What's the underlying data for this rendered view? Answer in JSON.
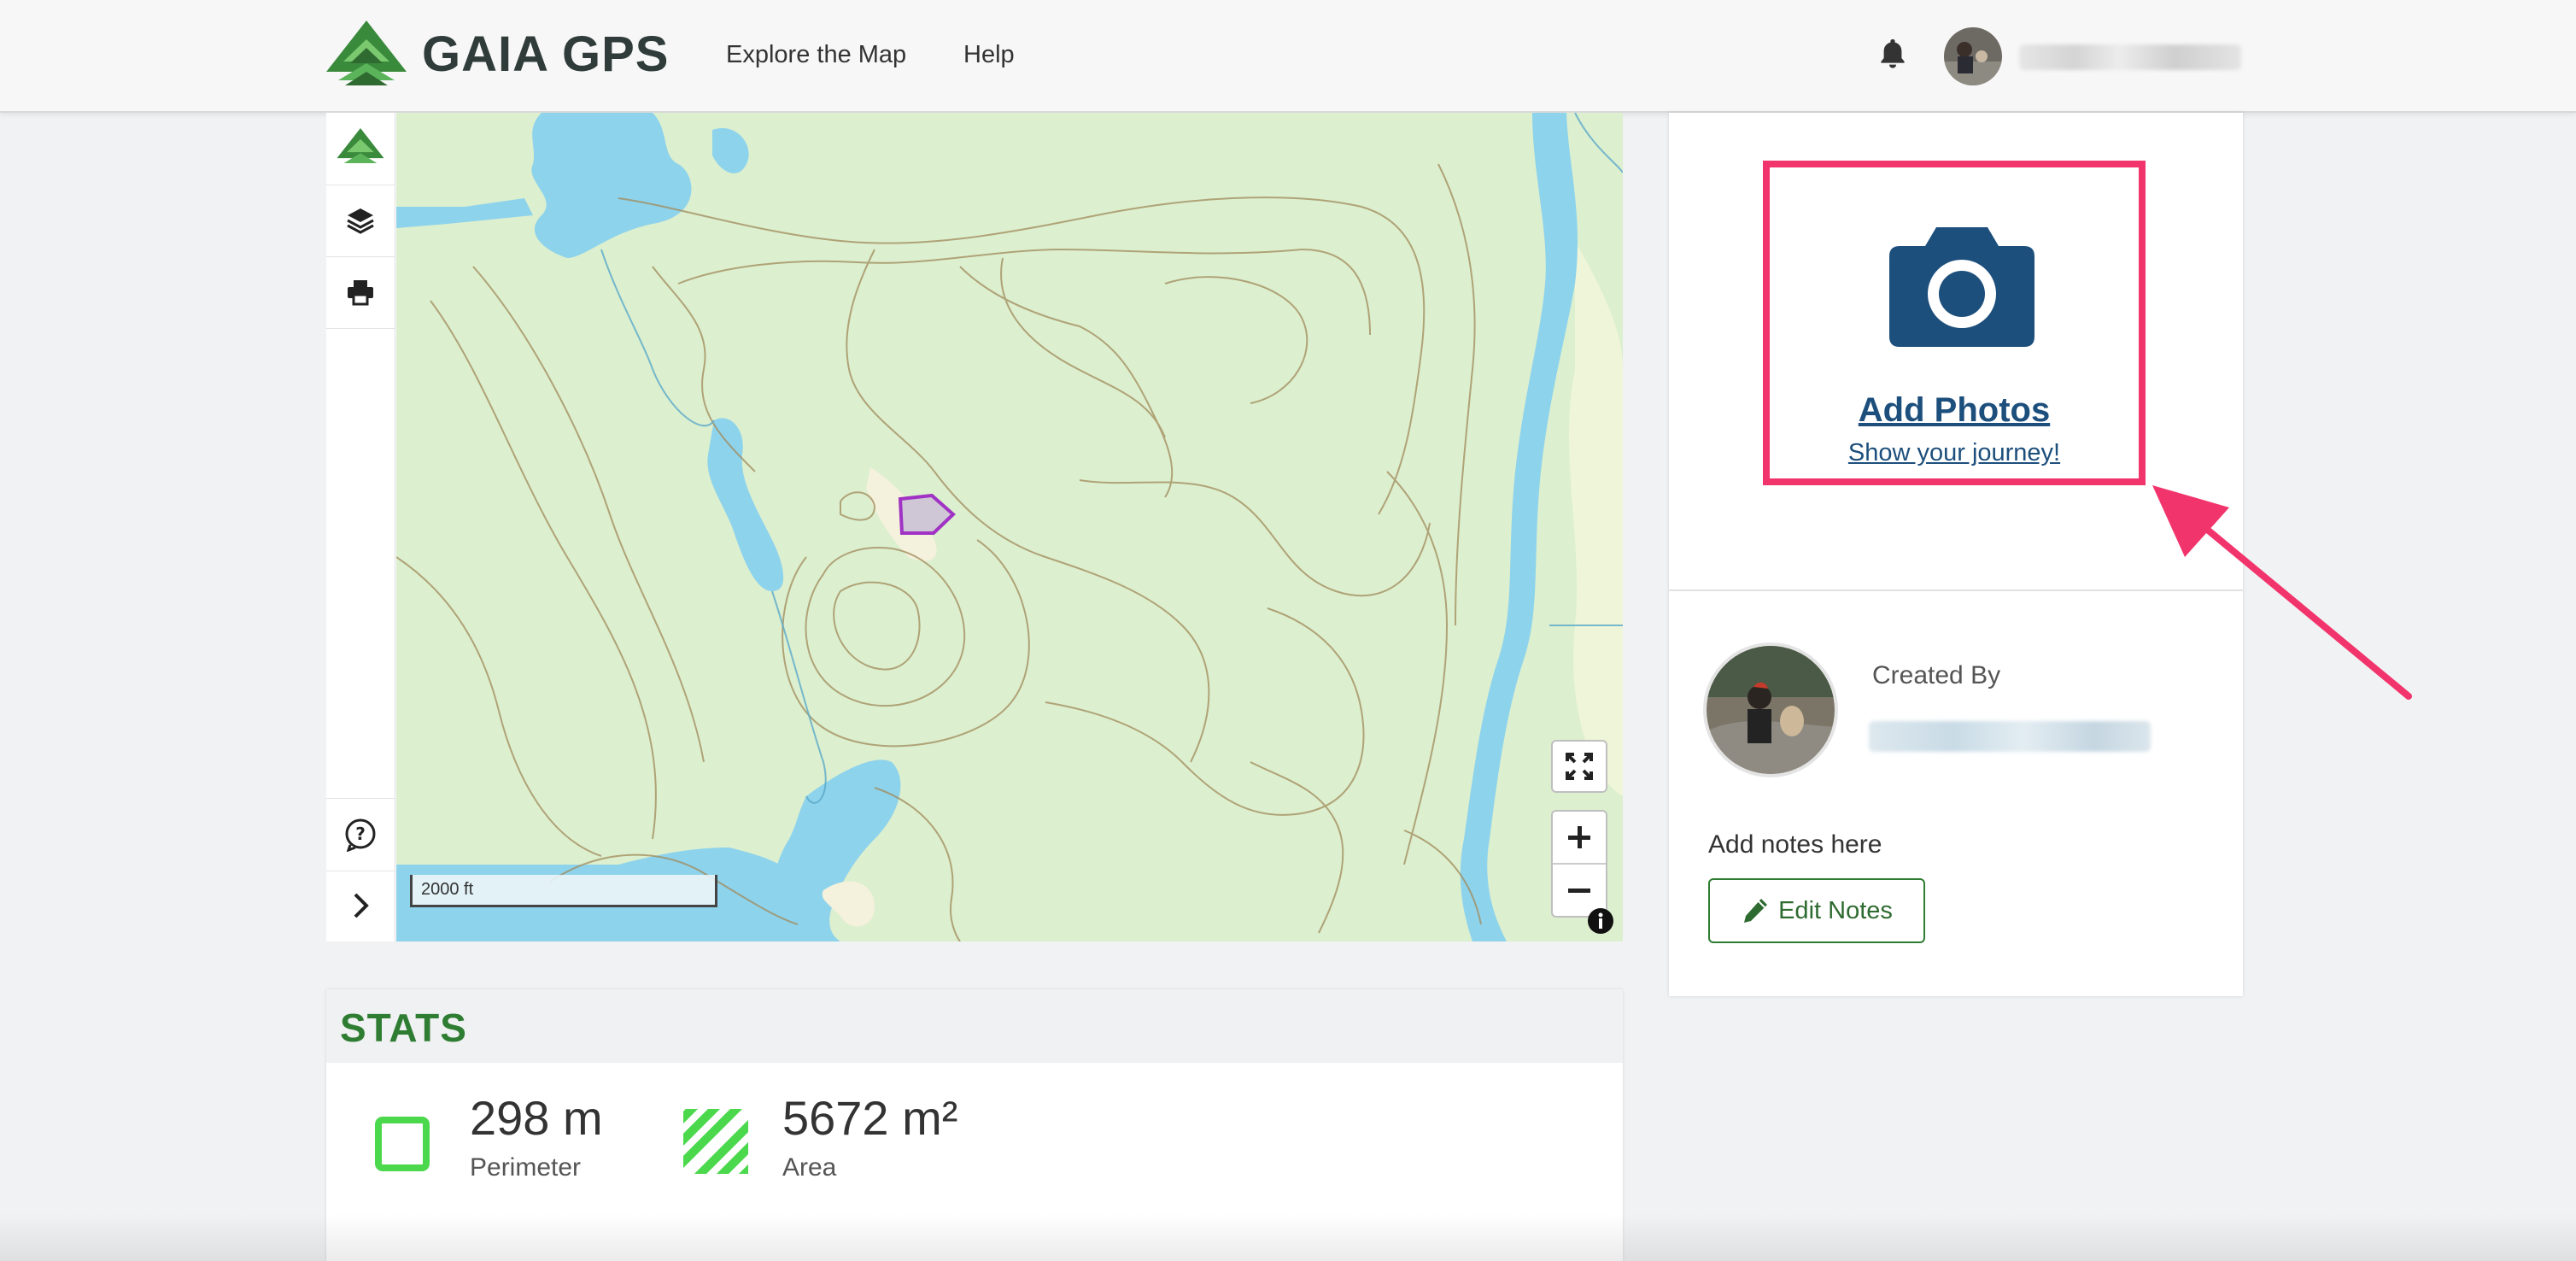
{
  "header": {
    "brand": "GAIA GPS",
    "nav": [
      "Explore the Map",
      "Help"
    ],
    "user_name_redacted": true
  },
  "map": {
    "scale_label": "2000 ft",
    "sidebar_tools": [
      "gaia-logo-icon",
      "layers-icon",
      "print-icon",
      "help-icon",
      "chevron-right-icon"
    ],
    "controls": [
      "fullscreen-icon",
      "zoom-in-icon",
      "zoom-out-icon",
      "info-icon"
    ]
  },
  "stats": {
    "title": "STATS",
    "perimeter": {
      "value": "298 m",
      "label": "Perimeter"
    },
    "area": {
      "value": "5672 m²",
      "label": "Area"
    }
  },
  "photos": {
    "add_label": "Add Photos",
    "subtitle": "Show your journey!"
  },
  "creator": {
    "created_by_label": "Created By",
    "notes_placeholder": "Add notes here",
    "edit_notes_label": "Edit Notes"
  },
  "colors": {
    "brand_green": "#2e7d32",
    "link_blue": "#1d4f7c",
    "highlight_pink": "#f2346c",
    "map_land": "#dcefcf",
    "water": "#8ed3ec"
  }
}
